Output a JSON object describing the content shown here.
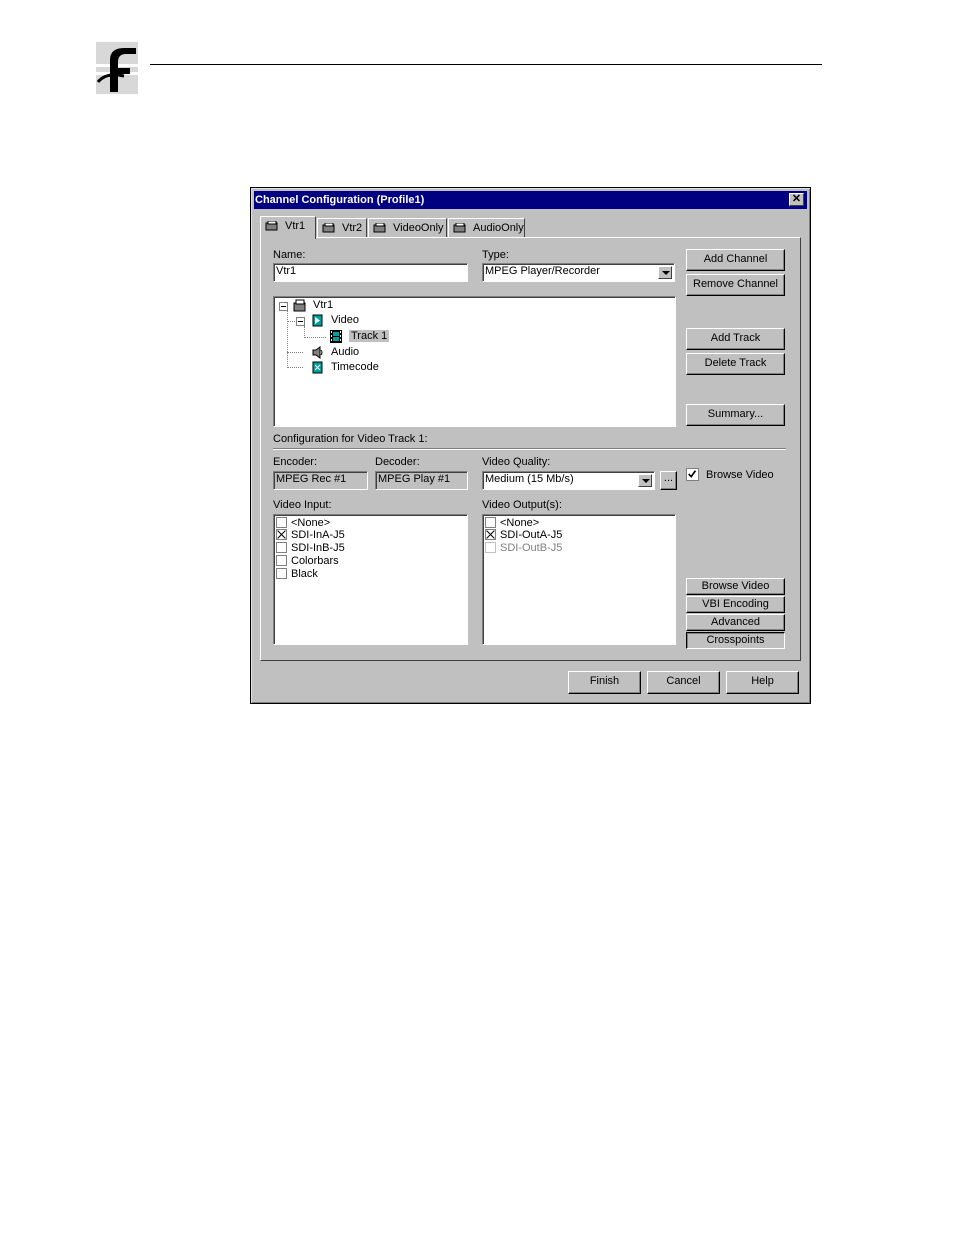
{
  "dialog": {
    "title": "Channel Configuration (Profile1)",
    "close_label": "✕"
  },
  "tabs": [
    "Vtr1",
    "Vtr2",
    "VideoOnly",
    "AudioOnly"
  ],
  "name_field": {
    "label": "Name:",
    "value": "Vtr1"
  },
  "type_field": {
    "label": "Type:",
    "value": "MPEG Player/Recorder"
  },
  "tree": {
    "root": "Vtr1",
    "video": "Video",
    "track": "Track 1",
    "audio": "Audio",
    "timecode": "Timecode"
  },
  "buttons": {
    "add_channel": "Add Channel",
    "remove_channel": "Remove Channel",
    "add_track": "Add Track",
    "delete_track": "Delete Track",
    "summary": "Summary...",
    "browse_video": "Browse Video",
    "vbi_encoding": "VBI Encoding",
    "advanced": "Advanced",
    "crosspoints": "Crosspoints",
    "finish": "Finish",
    "cancel": "Cancel",
    "help": "Help",
    "quality_more": "..."
  },
  "config_title": "Configuration for Video Track 1:",
  "encoder": {
    "label": "Encoder:",
    "value": "MPEG Rec #1"
  },
  "decoder": {
    "label": "Decoder:",
    "value": "MPEG Play #1"
  },
  "video_quality": {
    "label": "Video Quality:",
    "value": "Medium (15 Mb/s)"
  },
  "browse_video_checkbox": {
    "label": "Browse Video",
    "checked": true
  },
  "video_input": {
    "label": "Video Input:",
    "items": [
      {
        "text": "<None>",
        "checked": false
      },
      {
        "text": "SDI-InA-J5",
        "checked": true
      },
      {
        "text": "SDI-InB-J5",
        "checked": false
      },
      {
        "text": "Colorbars",
        "checked": false
      },
      {
        "text": "Black",
        "checked": false
      }
    ]
  },
  "video_output": {
    "label": "Video Output(s):",
    "items": [
      {
        "text": "<None>",
        "checked": false,
        "disabled": false
      },
      {
        "text": "SDI-OutA-J5",
        "checked": true,
        "disabled": false
      },
      {
        "text": "SDI-OutB-J5",
        "checked": false,
        "disabled": true
      }
    ]
  },
  "colors": {
    "title_bar": "#000080",
    "face": "#c0c0c0"
  }
}
